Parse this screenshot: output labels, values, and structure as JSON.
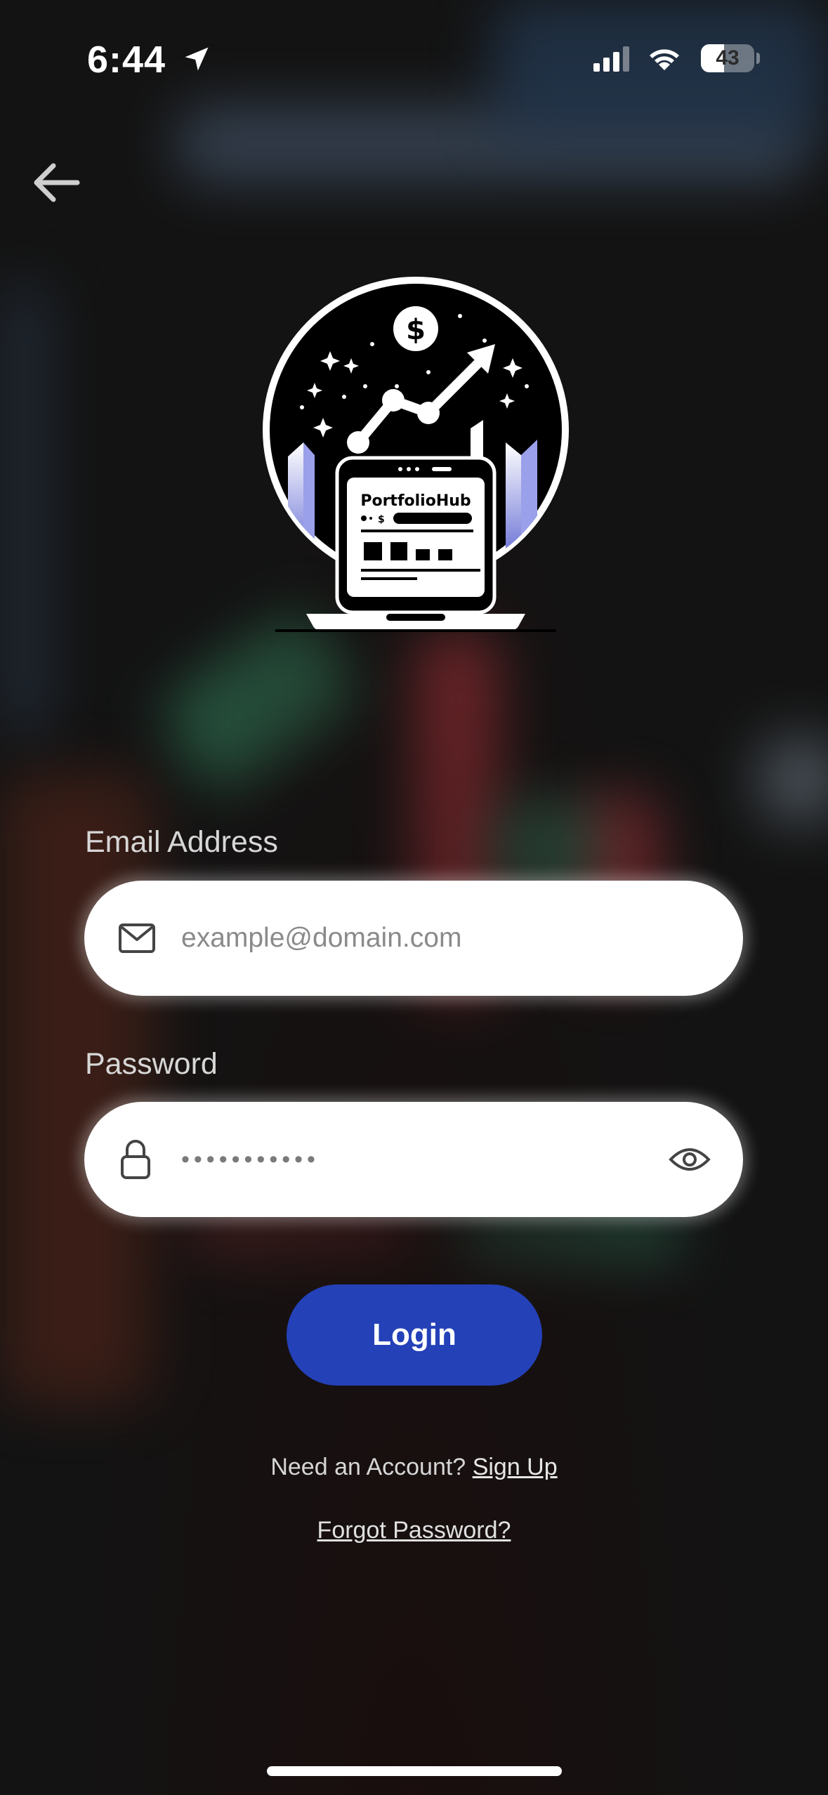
{
  "status_bar": {
    "time": "6:44",
    "battery": "43"
  },
  "logo": {
    "brand_text": "PortfolioHub"
  },
  "form": {
    "email_label": "Email Address",
    "email_placeholder": "example@domain.com",
    "password_label": "Password",
    "password_value": "•••••••••••"
  },
  "actions": {
    "login_label": "Login",
    "need_account_text": "Need an Account?",
    "signup_link": "Sign Up",
    "forgot_link": "Forgot Password?"
  },
  "icons": [
    "back-arrow-icon",
    "mail-icon",
    "lock-icon",
    "eye-icon",
    "location-arrow-icon",
    "cellular-signal-icon",
    "wifi-icon",
    "battery-icon"
  ],
  "colors": {
    "primary": "#2441b8",
    "field_bg": "#ffffff",
    "background": "#141414"
  }
}
